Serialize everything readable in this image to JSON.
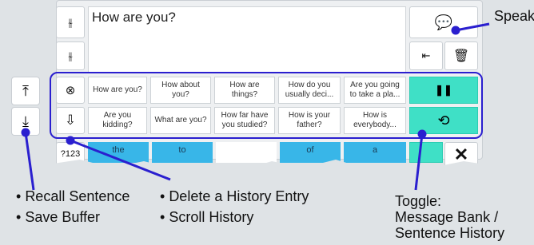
{
  "editor": {
    "text": "How are you?"
  },
  "history": {
    "row1": [
      "How are you?",
      "How about you?",
      "How are things?",
      "How do you usually deci...",
      "Are you going to take a pla..."
    ],
    "row2": [
      "Are you kidding?",
      "What are you?",
      "How far have you studied?",
      "How is your father?",
      "How is everybody..."
    ]
  },
  "keyboard": {
    "mode_key": "?123",
    "suggestions": [
      "the",
      "to",
      "",
      "of",
      "a"
    ]
  },
  "annotations": {
    "speak": "Speak",
    "recall": "Recall Sentence",
    "save": "Save Buffer",
    "delete": "Delete a History Entry",
    "scroll": "Scroll History",
    "toggle_1": "Toggle:",
    "toggle_2": "Message Bank /",
    "toggle_3": "Sentence History"
  },
  "colors": {
    "accent_teal": "#3fe0c6",
    "outline_blue": "#2a1fcf",
    "key_blue": "#38b6e8"
  },
  "icons": [
    "speak-icon",
    "backspace-icon",
    "trash-icon",
    "pause-icon",
    "delete-history-icon",
    "scroll-down-icon",
    "history-icon",
    "upload-icon",
    "download-icon",
    "close-icon"
  ]
}
